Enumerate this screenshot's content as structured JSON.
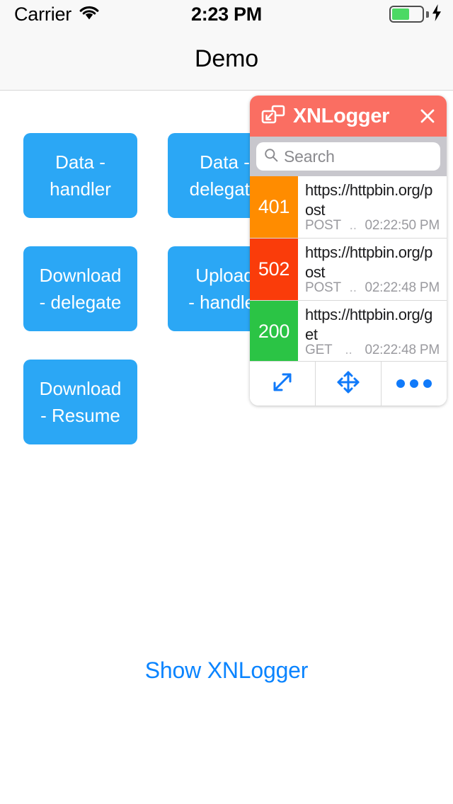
{
  "status_bar": {
    "carrier": "Carrier",
    "wifi_icon": "wifi-icon",
    "time": "2:23 PM",
    "battery_icon": "battery-icon",
    "charging_icon": "lightning-bolt-icon",
    "battery_level_percent": 45
  },
  "nav_bar": {
    "title": "Demo"
  },
  "main": {
    "buttons": [
      {
        "label": "Data -\nhandler",
        "name": "data-handler-button"
      },
      {
        "label": "Data -\ndelegate",
        "name": "data-delegate-button"
      },
      {
        "label": "Download\n- delegate",
        "name": "download-delegate-button"
      },
      {
        "label": "Upload\n- handler",
        "name": "upload-handler-button"
      },
      {
        "label": "Download\n- Resume",
        "name": "download-resume-button"
      }
    ],
    "show_logger_link": "Show XNLogger"
  },
  "logger_panel": {
    "title": "XNLogger",
    "minimize_icon": "restore-window-icon",
    "close_icon": "close-icon",
    "search": {
      "placeholder": "Search",
      "value": "",
      "icon": "search-icon"
    },
    "rows": [
      {
        "status": "401",
        "status_color": "#FF8C00",
        "url": "https://httpbin.org/post",
        "method": "POST",
        "separator": "..",
        "time": "02:22:50 PM"
      },
      {
        "status": "502",
        "status_color": "#FA3C0A",
        "url": "https://httpbin.org/post",
        "method": "POST",
        "separator": "..",
        "time": "02:22:48 PM"
      },
      {
        "status": "200",
        "status_color": "#2BC445",
        "url": "https://httpbin.org/get",
        "method": "GET",
        "separator": "..",
        "time": "02:22:48 PM"
      }
    ],
    "toolbar": [
      {
        "name": "resize-button",
        "icon": "resize-diagonal-icon"
      },
      {
        "name": "move-button",
        "icon": "move-arrows-icon"
      },
      {
        "name": "more-button",
        "icon": "more-dots-icon"
      }
    ]
  },
  "colors": {
    "accent_blue": "#2BA7F5",
    "link_blue": "#0a84ff",
    "logger_header": "#FA6E62",
    "icon_blue": "#107AFA"
  }
}
